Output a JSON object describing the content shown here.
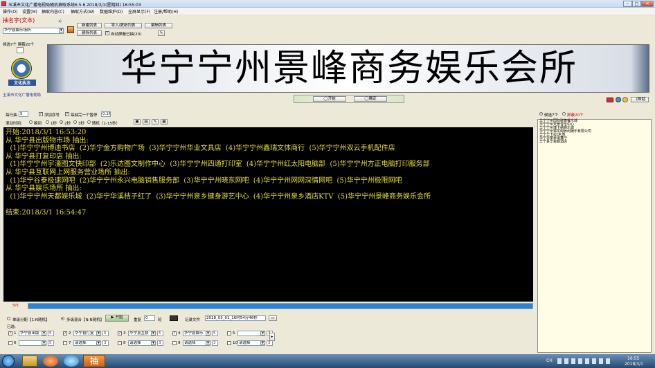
{
  "window": {
    "title": "玉溪市文化广播电视局随机抽取系统6.5.6 2018/3/1(星期四) 16:55:03",
    "controls": [
      "–",
      "□",
      "×"
    ]
  },
  "menu": [
    "操作(O)",
    "设置(M)",
    "抽取内容(C)",
    "抽取方式(W)",
    "数据维护(D)",
    "全屏显示(F)",
    "注册/帮助(H)"
  ],
  "left": {
    "section_title": "抽名字(文本)",
    "list_select": "华宁县娱乐场所",
    "btn_new": "新建列表",
    "btn_import": "导入/更新列表",
    "btn_edit": "编辑列表",
    "btn_delete": "删除列表",
    "auto_hide_label": "自动屏蔽已抽(20)",
    "counts": "候选7个 屏蔽20个",
    "logo_text": "文化执法",
    "org_name": "玉溪市文化广播电视局"
  },
  "banner": "华宁宁州景峰商务娱乐会所",
  "controls": {
    "start": "◯开始",
    "confirm": "◯确定",
    "per_line_label": "每行抽",
    "per_line_value": "5",
    "add_number_label": "添加序号",
    "pause_label": "每抽完一个暂停",
    "pause_value": "0.1秒",
    "scroll_label": "滚动时间：",
    "scroll_options": [
      "瞬间",
      "1秒",
      "2秒",
      "3秒",
      "随机（1-15秒）"
    ],
    "scroll_selected": 2,
    "right_counts": "候选7个",
    "right_shielded": "屏蔽20个",
    "help": "《帮助"
  },
  "console": [
    "开始:2018/3/1 16:53:20",
    "从 华宁县出版物市场 抽出:",
    "  (1)华宁宁州博迪书店  (2)华宁金方购物广场  (3)华宁宁州华业文具店  (4)华宁宁州鑫瑞文体商行  (5)华宁宁州双云手机配件店",
    "从 华宁县打复印店 抽出:",
    "  (1)华宁宁州宇濠图文快印部  (2)乐达图文制作中心  (3)华宁宁州四通打印室  (4)华宁宁州红太阳电脑部  (5)华宁宁州方正电脑打印服务部",
    "从 华宁县互联网上网服务营业场所 抽出:",
    "  (1)华宁谷泰极速网吧  (2)华宁宁州永兴电脑销售服务部  (3)华宁宁州晓东网吧  (4)华宁宁州网网深情网吧  (5)华宁宁州极限网吧",
    "从 华宁县娱乐场所 抽出:",
    "  (1)华宁宁州天都娱乐城  (2)华宁华溪桔子红了  (3)华宁宁州泉乡健身游艺中心  (4)华宁宁州泉乡酒店KTV  (5)华宁宁州景峰商务娱乐会所",
    "",
    "结束:2018/3/1 16:54:47"
  ],
  "right_list": [
    "华宁宁州国际歌舞餐乐城",
    "华宁宁州天景音乐中心",
    "华宁宁州博卡纳娱乐城",
    "华宁宁州锦龙阁休闲娱乐有限公司",
    "华宁华卡拉OK城",
    "华宁华丽豪歌舞厅",
    "华宁县华金都酒店"
  ],
  "progress": {
    "label": "5/5",
    "value": 1.0
  },
  "bottom": {
    "mode_single": "单级分配【1:N随机】",
    "mode_multi": "多级混合【N:N随机】",
    "start": "开始",
    "repeat_label": "重复",
    "repeat_value": "0",
    "round_label": "轮",
    "record_label": "记录文件",
    "record_file": "2018_03_01_16时54分46秒",
    "selected_label": "已选:",
    "slots": [
      {
        "num": "1",
        "checked": true,
        "value": "华宁县出版",
        "count": "5"
      },
      {
        "num": "2",
        "checked": true,
        "value": "华宁县打复",
        "count": "5"
      },
      {
        "num": "3",
        "checked": true,
        "value": "华宁县互联",
        "count": "5"
      },
      {
        "num": "4",
        "checked": true,
        "value": "华宁县娱乐",
        "count": "5"
      },
      {
        "num": "5",
        "checked": false,
        "value": "",
        "count": "3"
      },
      {
        "num": "6",
        "checked": false,
        "value": "",
        "count": "5"
      },
      {
        "num": "7",
        "checked": false,
        "value": "请选择",
        "count": "3"
      },
      {
        "num": "8",
        "checked": false,
        "value": "请选择",
        "count": "3"
      },
      {
        "num": "9",
        "checked": false,
        "value": "请选择",
        "count": "3"
      },
      {
        "num": "10",
        "checked": false,
        "value": "请选择",
        "count": "3"
      }
    ]
  },
  "taskbar": {
    "time": "16:55",
    "date": "2018/3/1",
    "app_label": "抽",
    "lang": "CH"
  },
  "colors": {
    "console_bg": "#000000",
    "console_text": "#e8dd3b",
    "progress_fill": "#2f80d8",
    "banner_text": "#000000"
  }
}
